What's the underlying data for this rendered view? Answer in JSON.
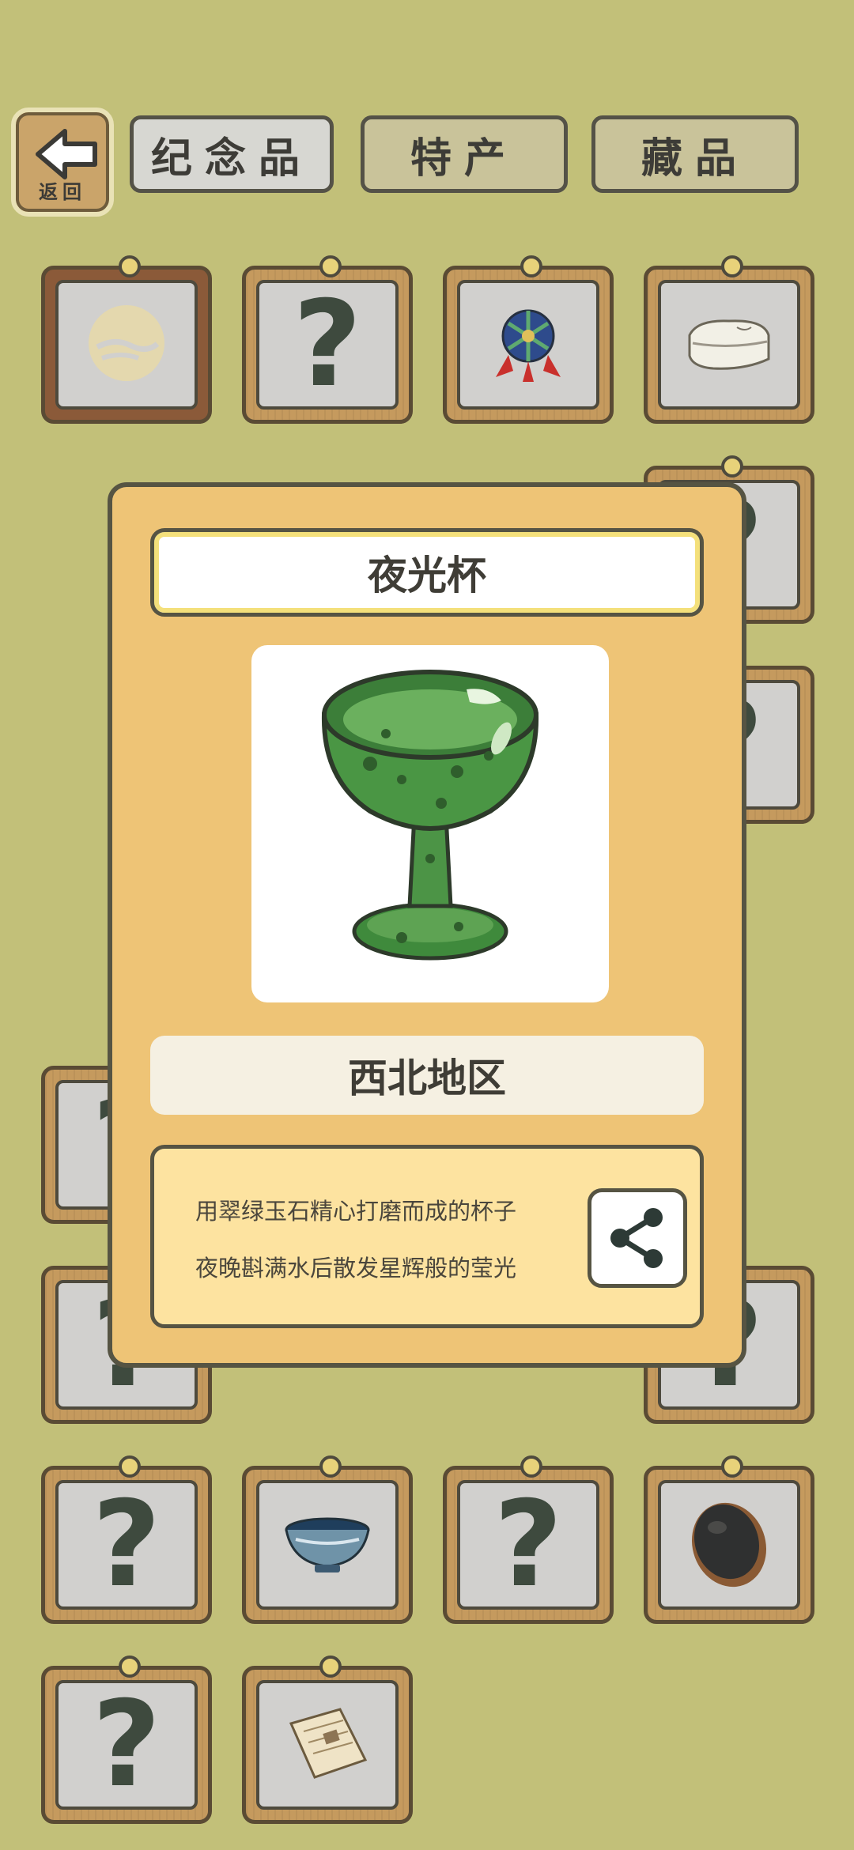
{
  "header": {
    "back_label": "返回",
    "tabs": [
      {
        "label": "纪念品",
        "active": true
      },
      {
        "label": "特产",
        "active": false
      },
      {
        "label": "藏品",
        "active": false
      }
    ]
  },
  "grid": {
    "unknown_mark": "?",
    "items": [
      {
        "type": "item",
        "icon": "moon-emblem-icon",
        "faded": true
      },
      {
        "type": "unknown"
      },
      {
        "type": "item",
        "icon": "temari-ball-icon"
      },
      {
        "type": "item",
        "icon": "folded-cloth-icon"
      },
      {
        "type": "hidden"
      },
      {
        "type": "hidden"
      },
      {
        "type": "hidden"
      },
      {
        "type": "unknown"
      },
      {
        "type": "hidden"
      },
      {
        "type": "hidden"
      },
      {
        "type": "hidden"
      },
      {
        "type": "unknown"
      },
      {
        "type": "hidden"
      },
      {
        "type": "hidden"
      },
      {
        "type": "hidden"
      },
      {
        "type": "hidden"
      },
      {
        "type": "unknown"
      },
      {
        "type": "hidden"
      },
      {
        "type": "hidden"
      },
      {
        "type": "hidden"
      },
      {
        "type": "unknown"
      },
      {
        "type": "hidden"
      },
      {
        "type": "hidden"
      },
      {
        "type": "unknown"
      },
      {
        "type": "unknown"
      },
      {
        "type": "item",
        "icon": "porcelain-bowl-icon"
      },
      {
        "type": "unknown"
      },
      {
        "type": "item",
        "icon": "inkstone-icon"
      },
      {
        "type": "unknown"
      },
      {
        "type": "item",
        "icon": "book-icon"
      }
    ]
  },
  "detail": {
    "name": "夜光杯",
    "image_icon": "jade-cup-icon",
    "region": "西北地区",
    "description_lines": [
      "用翠绿玉石精心打磨而成的杯子",
      "夜晚斟满水后散发星辉般的莹光"
    ],
    "share_icon": "share-icon"
  },
  "colors": {
    "background": "#c2c079",
    "dialog": "#eec476",
    "card_wood": "#c59a5e",
    "jade": "#3f8a3c"
  }
}
